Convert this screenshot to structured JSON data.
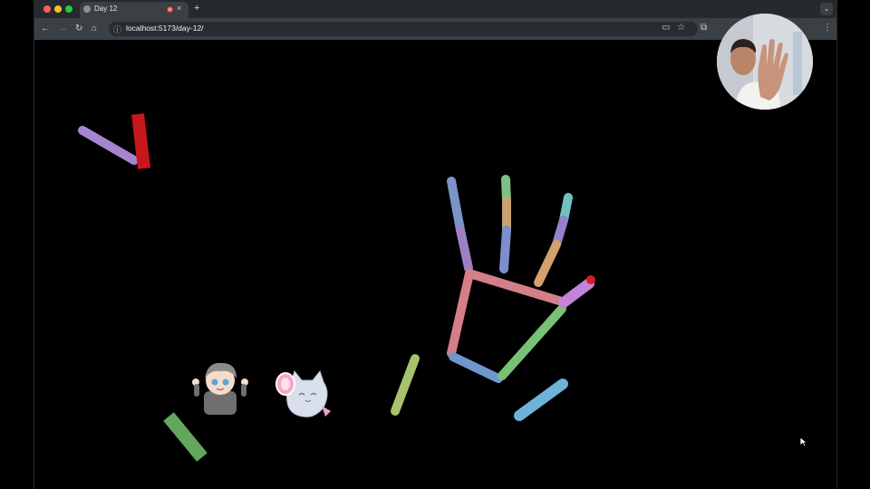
{
  "browser": {
    "tab_title": "Day 12",
    "tab_close": "×",
    "new_tab": "+",
    "url": "localhost:5173/day-12/",
    "colors": {
      "close": "#ff5f57",
      "minimize": "#febc2e",
      "zoom": "#28c840"
    }
  },
  "toolbar": {
    "back": "←",
    "forward": "→",
    "reload": "↻",
    "home": "⌂",
    "info": "ⓘ",
    "cast": "▭",
    "bookmark": "☆",
    "extensions": "⧉",
    "menu": "⋮",
    "tab_search": "⌄"
  },
  "scene": {
    "icons": [
      "hand-skeleton",
      "webcam-preview",
      "sticker-character-boy",
      "sticker-character-cat",
      "mouse-cursor"
    ]
  }
}
